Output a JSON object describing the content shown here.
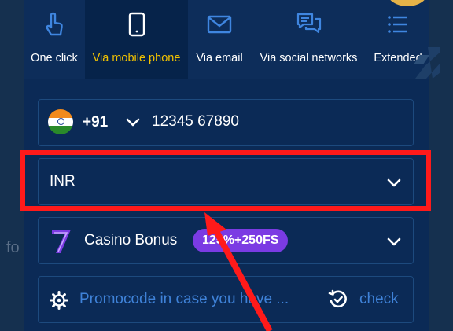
{
  "background": {
    "side_text": "fo"
  },
  "tabs": [
    {
      "label": "One click",
      "icon": "hand-pointer-icon",
      "active": false
    },
    {
      "label": "Via mobile phone",
      "icon": "mobile-phone-icon",
      "active": true
    },
    {
      "label": "Via email",
      "icon": "envelope-icon",
      "active": false
    },
    {
      "label": "Via social networks",
      "icon": "chat-bubbles-icon",
      "active": false
    },
    {
      "label": "Extended",
      "icon": "list-icon",
      "active": false
    }
  ],
  "phone": {
    "country_flag": "india-flag-icon",
    "code": "+91",
    "number": "12345 67890"
  },
  "currency": {
    "value": "INR"
  },
  "bonus": {
    "label": "Casino Bonus",
    "badge": "125%+250FS"
  },
  "promo": {
    "placeholder": "Promocode in case you have ...",
    "check_label": "check"
  },
  "colors": {
    "accent_active_tab": "#f2c200",
    "highlight": "#ff1a1a",
    "badge": "#7b3be3",
    "link": "#3f82d8"
  }
}
